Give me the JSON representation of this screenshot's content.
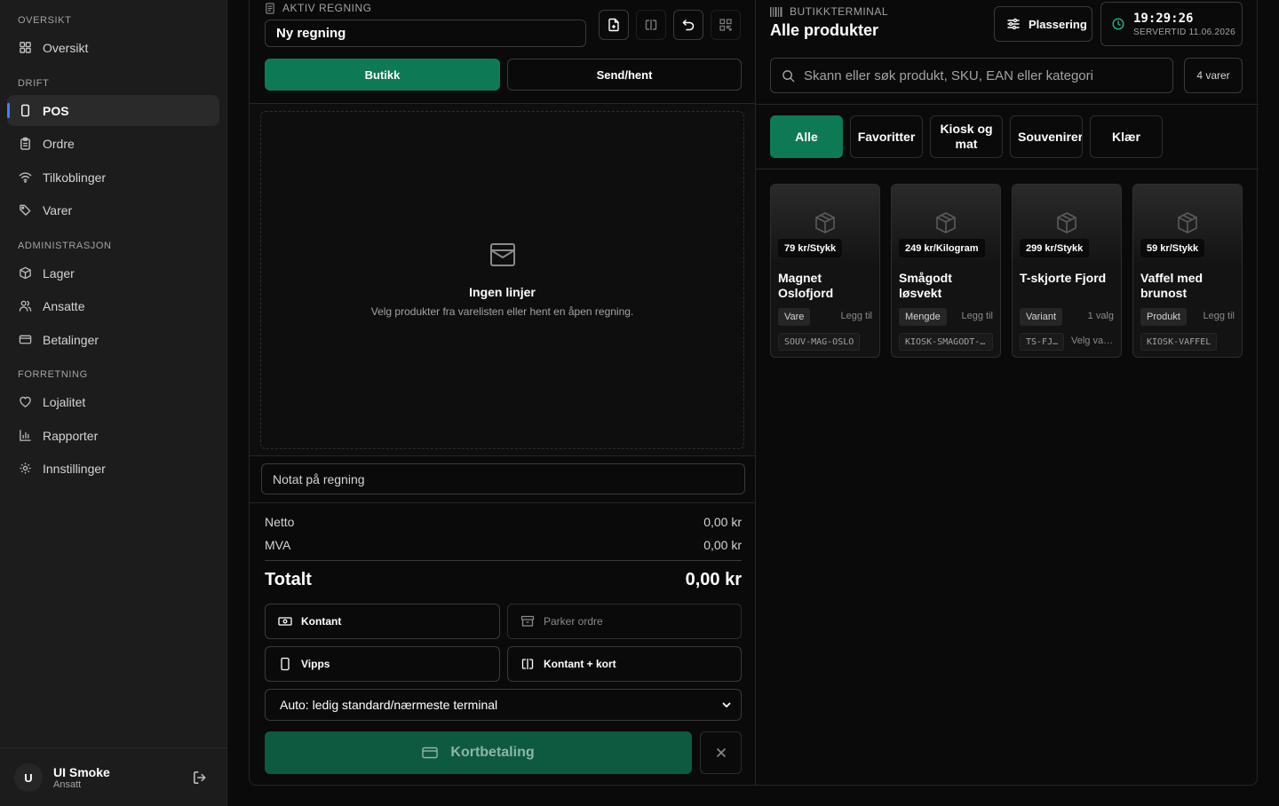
{
  "sidebar": {
    "sections": {
      "overview": "OVERSIKT",
      "operations": "DRIFT",
      "admin": "ADMINISTRASJON",
      "business": "FORRETNING"
    },
    "items": [
      {
        "label": "Oversikt",
        "icon": "grid-icon"
      },
      {
        "label": "POS",
        "icon": "tablet-icon",
        "active": true
      },
      {
        "label": "Ordre",
        "icon": "clipboard-icon"
      },
      {
        "label": "Tilkoblinger",
        "icon": "wifi-icon"
      },
      {
        "label": "Varer",
        "icon": "tags-icon"
      },
      {
        "label": "Lager",
        "icon": "box-icon"
      },
      {
        "label": "Ansatte",
        "icon": "users-icon"
      },
      {
        "label": "Betalinger",
        "icon": "credit-card-icon"
      },
      {
        "label": "Lojalitet",
        "icon": "heart-icon"
      },
      {
        "label": "Rapporter",
        "icon": "bar-chart-icon"
      },
      {
        "label": "Innstillinger",
        "icon": "gear-icon"
      }
    ],
    "user": {
      "initial": "U",
      "name": "UI Smoke",
      "role": "Ansatt"
    }
  },
  "bill": {
    "eyebrow": "AKTIV REGNING",
    "name_value": "Ny regning",
    "modes": {
      "store": "Butikk",
      "send": "Send/hent"
    },
    "empty_title": "Ingen linjer",
    "empty_sub": "Velg produkter fra varelisten eller hent en åpen regning.",
    "note_placeholder": "Notat på regning",
    "netto_label": "Netto",
    "netto_value": "0,00 kr",
    "vat_label": "MVA",
    "vat_value": "0,00 kr",
    "total_label": "Totalt",
    "total_value": "0,00 kr",
    "buttons": {
      "cash": "Kontant",
      "park": "Parker ordre",
      "vipps": "Vipps",
      "split": "Kontant + kort"
    },
    "terminal_select": "Auto: ledig standard/nærmeste terminal",
    "card_payment": "Kortbetaling"
  },
  "catalog": {
    "eyebrow": "BUTIKKTERMINAL",
    "title": "Alle produkter",
    "placement": "Plassering",
    "clock_time": "19:29:26",
    "clock_date": "SERVERTID 11.06.2026",
    "search_placeholder": "Skann eller søk produkt, SKU, EAN eller kategori",
    "count": "4 varer",
    "categories": [
      {
        "label": "Alle",
        "active": true
      },
      {
        "label": "Favoritter"
      },
      {
        "label": "Kiosk og mat"
      },
      {
        "label": "Souvenirer"
      },
      {
        "label": "Klær"
      }
    ],
    "products": [
      {
        "price": "79 kr/Stykk",
        "name": "Magnet Oslofjord",
        "tag": "Vare",
        "action": "Legg til",
        "sku": "SOUV-MAG-OSLO",
        "sku_hint": ""
      },
      {
        "price": "249 kr/Kilogram",
        "name": "Smågodt løsvekt",
        "tag": "Mengde",
        "action": "Legg til",
        "sku": "KIOSK-SMAGODT-…",
        "sku_hint": ""
      },
      {
        "price": "299 kr/Stykk",
        "name": "T-skjorte Fjord",
        "tag": "Variant",
        "action": "1 valg",
        "sku": "TS-FJ…",
        "sku_hint": "Velg va…"
      },
      {
        "price": "59 kr/Stykk",
        "name": "Vaffel med brunost",
        "tag": "Produkt",
        "action": "Legg til",
        "sku": "KIOSK-VAFFEL",
        "sku_hint": ""
      }
    ]
  },
  "colors": {
    "accent": "#0e7a55",
    "active_indicator": "#3b82f6"
  }
}
